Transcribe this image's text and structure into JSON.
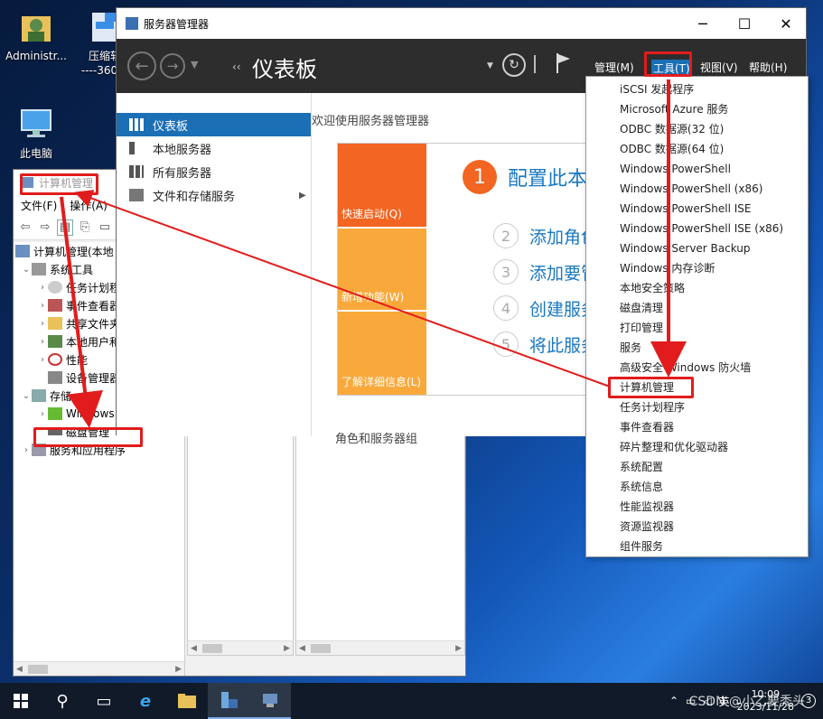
{
  "desktop": {
    "icons": [
      {
        "label": "Administr..."
      },
      {
        "label": "压缩软",
        "sublabel": "----360压"
      },
      {
        "label": "此电脑"
      }
    ]
  },
  "computer_management": {
    "title": "计算机管理",
    "menu": [
      "文件(F)",
      "操作(A)"
    ],
    "tree": [
      {
        "label": "计算机管理(本地"
      },
      {
        "label": "系统工具"
      },
      {
        "label": "任务计划程"
      },
      {
        "label": "事件查看器"
      },
      {
        "label": "共享文件夹"
      },
      {
        "label": "本地用户和"
      },
      {
        "label": "性能"
      },
      {
        "label": "设备管理器"
      },
      {
        "label": "存储"
      },
      {
        "label": "Windows"
      },
      {
        "label": "磁盘管理"
      },
      {
        "label": "服务和应用程序"
      }
    ]
  },
  "server_manager": {
    "window_title": "服务器管理器",
    "page_title": "仪表板",
    "menu": {
      "manage": "管理(M)",
      "tools": "工具(T)",
      "view": "视图(V)",
      "help": "帮助(H)"
    },
    "nav": [
      {
        "label": "仪表板",
        "active": true
      },
      {
        "label": "本地服务器"
      },
      {
        "label": "所有服务器"
      },
      {
        "label": "文件和存储服务"
      }
    ],
    "welcome": "欢迎使用服务器管理器",
    "tiles": {
      "quick_start": "快速启动(Q)",
      "whats_new": "新增功能(W)",
      "learn_more": "了解详细信息(L)"
    },
    "steps": [
      {
        "num": "1",
        "label": "配置此本"
      },
      {
        "num": "2",
        "label": "添加角色"
      },
      {
        "num": "3",
        "label": "添加要管"
      },
      {
        "num": "4",
        "label": "创建服务"
      },
      {
        "num": "5",
        "label": "将此服务"
      }
    ],
    "roles_heading": "角色和服务器组"
  },
  "tools_menu": {
    "items": [
      "iSCSI 发起程序",
      "Microsoft Azure 服务",
      "ODBC 数据源(32 位)",
      "ODBC 数据源(64 位)",
      "Windows PowerShell",
      "Windows PowerShell (x86)",
      "Windows PowerShell ISE",
      "Windows PowerShell ISE (x86)",
      "Windows Server Backup",
      "Windows 内存诊断",
      "本地安全策略",
      "磁盘清理",
      "打印管理",
      "服务",
      "高级安全 Windows 防火墙",
      "计算机管理",
      "任务计划程序",
      "事件查看器",
      "碎片整理和优化驱动器",
      "系统配置",
      "系统信息",
      "性能监视器",
      "资源监视器",
      "组件服务"
    ]
  },
  "taskbar": {
    "ime": "英",
    "time": "10:09",
    "date": "2023/11/28",
    "watermark": "CSDN @小乙要秃头",
    "notify_count": "3"
  },
  "colors": {
    "accent_blue": "#1a6fb5",
    "orange": "#f26522",
    "light_orange": "#f9a93c",
    "annotation_red": "#e21c1c"
  }
}
